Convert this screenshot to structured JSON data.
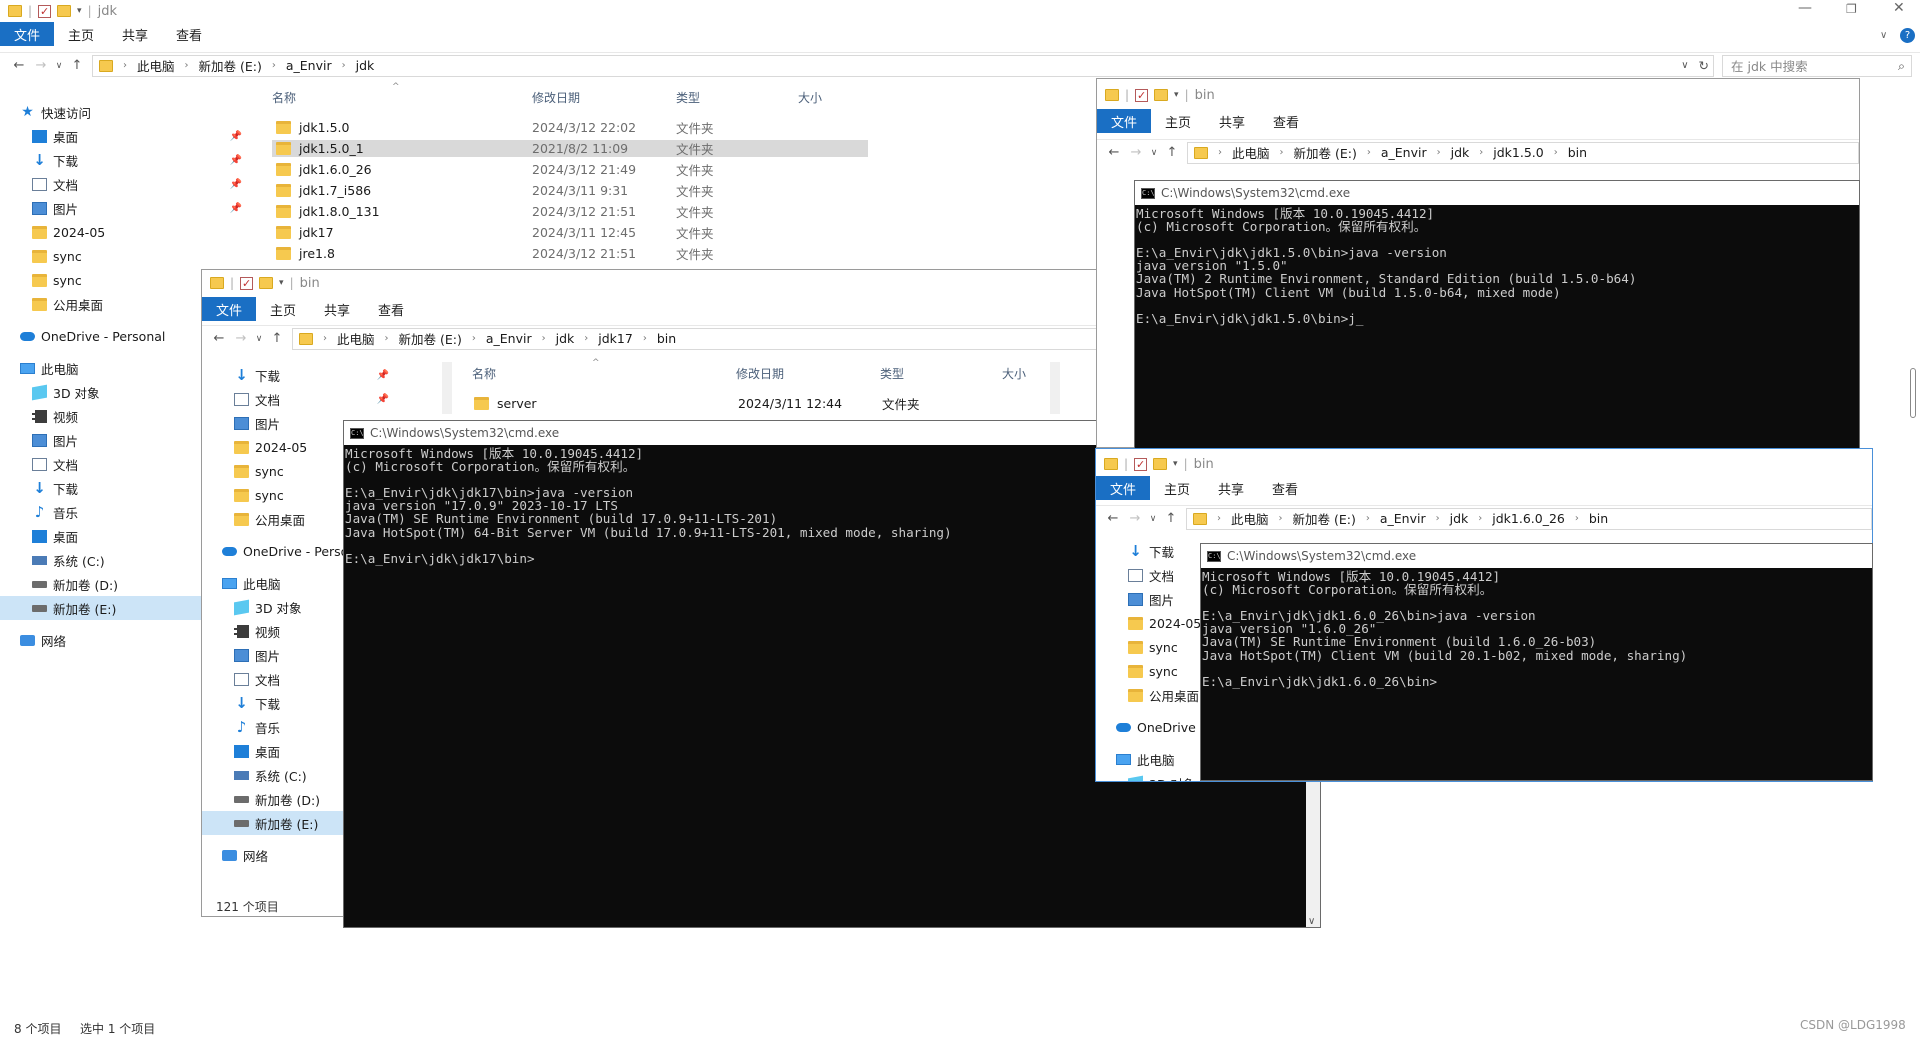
{
  "main": {
    "title": "jdk",
    "ribbon": [
      "文件",
      "主页",
      "共享",
      "查看"
    ],
    "breadcrumb": [
      "此电脑",
      "新加卷 (E:)",
      "a_Envir",
      "jdk"
    ],
    "search_placeholder": "在 jdk 中搜索",
    "columns": [
      "名称",
      "修改日期",
      "类型",
      "大小"
    ],
    "files": [
      {
        "name": "jdk1.5.0",
        "date": "2024/3/12 22:02",
        "type": "文件夹"
      },
      {
        "name": "jdk1.5.0_1",
        "date": "2021/8/2 11:09",
        "type": "文件夹"
      },
      {
        "name": "jdk1.6.0_26",
        "date": "2024/3/12 21:49",
        "type": "文件夹"
      },
      {
        "name": "jdk1.7_i586",
        "date": "2024/3/11 9:31",
        "type": "文件夹"
      },
      {
        "name": "jdk1.8.0_131",
        "date": "2024/3/12 21:51",
        "type": "文件夹"
      },
      {
        "name": "jdk17",
        "date": "2024/3/11 12:45",
        "type": "文件夹"
      },
      {
        "name": "jre1.8",
        "date": "2024/3/12 21:51",
        "type": "文件夹"
      }
    ],
    "nav": [
      {
        "label": "快速访问",
        "icon": "star-icon"
      },
      {
        "label": "桌面",
        "icon": "desktop-icon"
      },
      {
        "label": "下载",
        "icon": "download-icon"
      },
      {
        "label": "文档",
        "icon": "documents-icon"
      },
      {
        "label": "图片",
        "icon": "pictures-icon"
      },
      {
        "label": "2024-05",
        "icon": "folder-icon"
      },
      {
        "label": "sync",
        "icon": "folder-icon"
      },
      {
        "label": "sync",
        "icon": "folder-icon"
      },
      {
        "label": "公用桌面",
        "icon": "folder-icon"
      },
      {
        "label": "OneDrive - Personal",
        "icon": "cloud-icon"
      },
      {
        "label": "此电脑",
        "icon": "pc-icon"
      },
      {
        "label": "3D 对象",
        "icon": "3d-objects-icon"
      },
      {
        "label": "视频",
        "icon": "video-icon"
      },
      {
        "label": "图片",
        "icon": "pictures-icon"
      },
      {
        "label": "文档",
        "icon": "documents-icon"
      },
      {
        "label": "下载",
        "icon": "download-icon"
      },
      {
        "label": "音乐",
        "icon": "music-icon"
      },
      {
        "label": "桌面",
        "icon": "desktop-icon"
      },
      {
        "label": "系统 (C:)",
        "icon": "system-drive-icon"
      },
      {
        "label": "新加卷 (D:)",
        "icon": "drive-icon"
      },
      {
        "label": "新加卷 (E:)",
        "icon": "drive-icon"
      },
      {
        "label": "网络",
        "icon": "network-icon"
      }
    ],
    "status_items": "8 个项目",
    "status_selected": "选中 1 个项目",
    "watermark": "CSDN @LDG1998"
  },
  "win17": {
    "title": "bin",
    "ribbon": [
      "文件",
      "主页",
      "共享",
      "查看"
    ],
    "breadcrumb": [
      "此电脑",
      "新加卷 (E:)",
      "a_Envir",
      "jdk",
      "jdk17",
      "bin"
    ],
    "columns": [
      "名称",
      "修改日期",
      "类型",
      "大小"
    ],
    "row": {
      "name": "server",
      "date": "2024/3/11 12:44",
      "type": "文件夹"
    },
    "nav": [
      {
        "label": "下载",
        "icon": "download-icon"
      },
      {
        "label": "文档",
        "icon": "documents-icon"
      },
      {
        "label": "图片",
        "icon": "pictures-icon"
      },
      {
        "label": "2024-05",
        "icon": "folder-icon"
      },
      {
        "label": "sync",
        "icon": "folder-icon"
      },
      {
        "label": "sync",
        "icon": "folder-icon"
      },
      {
        "label": "公用桌面",
        "icon": "folder-icon"
      },
      {
        "label": "OneDrive - Perso",
        "icon": "cloud-icon"
      },
      {
        "label": "此电脑",
        "icon": "pc-icon"
      },
      {
        "label": "3D 对象",
        "icon": "3d-objects-icon"
      },
      {
        "label": "视频",
        "icon": "video-icon"
      },
      {
        "label": "图片",
        "icon": "pictures-icon"
      },
      {
        "label": "文档",
        "icon": "documents-icon"
      },
      {
        "label": "下载",
        "icon": "download-icon"
      },
      {
        "label": "音乐",
        "icon": "music-icon"
      },
      {
        "label": "桌面",
        "icon": "desktop-icon"
      },
      {
        "label": "系统 (C:)",
        "icon": "system-drive-icon"
      },
      {
        "label": "新加卷 (D:)",
        "icon": "drive-icon"
      },
      {
        "label": "新加卷 (E:)",
        "icon": "drive-icon"
      },
      {
        "label": "网络",
        "icon": "network-icon"
      }
    ],
    "status": "121 个项目",
    "cmd_title": "C:\\Windows\\System32\\cmd.exe",
    "cmd_lines": [
      "Microsoft Windows [版本 10.0.19045.4412]",
      "(c) Microsoft Corporation。保留所有权利。",
      "",
      "E:\\a_Envir\\jdk\\jdk17\\bin>java -version",
      "java version \"17.0.9\" 2023-10-17 LTS",
      "Java(TM) SE Runtime Environment (build 17.0.9+11-LTS-201)",
      "Java HotSpot(TM) 64-Bit Server VM (build 17.0.9+11-LTS-201, mixed mode, sharing)",
      "",
      "E:\\a_Envir\\jdk\\jdk17\\bin>"
    ]
  },
  "win15": {
    "title": "bin",
    "ribbon": [
      "文件",
      "主页",
      "共享",
      "查看"
    ],
    "breadcrumb": [
      "此电脑",
      "新加卷 (E:)",
      "a_Envir",
      "jdk",
      "jdk1.5.0",
      "bin"
    ],
    "cmd_title": "C:\\Windows\\System32\\cmd.exe",
    "cmd_lines": [
      "Microsoft Windows [版本 10.0.19045.4412]",
      "(c) Microsoft Corporation。保留所有权利。",
      "",
      "E:\\a_Envir\\jdk\\jdk1.5.0\\bin>java -version",
      "java version \"1.5.0\"",
      "Java(TM) 2 Runtime Environment, Standard Edition (build 1.5.0-b64)",
      "Java HotSpot(TM) Client VM (build 1.5.0-b64, mixed mode)",
      "",
      "E:\\a_Envir\\jdk\\jdk1.5.0\\bin>j_"
    ]
  },
  "win16": {
    "title": "bin",
    "ribbon": [
      "文件",
      "主页",
      "共享",
      "查看"
    ],
    "breadcrumb": [
      "此电脑",
      "新加卷 (E:)",
      "a_Envir",
      "jdk",
      "jdk1.6.0_26",
      "bin"
    ],
    "nav": [
      {
        "label": "下载",
        "icon": "download-icon"
      },
      {
        "label": "文档",
        "icon": "documents-icon"
      },
      {
        "label": "图片",
        "icon": "pictures-icon"
      },
      {
        "label": "2024-05",
        "icon": "folder-icon"
      },
      {
        "label": "sync",
        "icon": "folder-icon"
      },
      {
        "label": "sync",
        "icon": "folder-icon"
      },
      {
        "label": "公用桌面",
        "icon": "folder-icon"
      },
      {
        "label": "OneDrive",
        "icon": "cloud-icon"
      },
      {
        "label": "此电脑",
        "icon": "pc-icon"
      },
      {
        "label": "3D 对象",
        "icon": "3d-objects-icon"
      }
    ],
    "cmd_title": "C:\\Windows\\System32\\cmd.exe",
    "cmd_lines": [
      "Microsoft Windows [版本 10.0.19045.4412]",
      "(c) Microsoft Corporation。保留所有权利。",
      "",
      "E:\\a_Envir\\jdk\\jdk1.6.0_26\\bin>java -version",
      "java version \"1.6.0_26\"",
      "Java(TM) SE Runtime Environment (build 1.6.0_26-b03)",
      "Java HotSpot(TM) Client VM (build 20.1-b02, mixed mode, sharing)",
      "",
      "E:\\a_Envir\\jdk\\jdk1.6.0_26\\bin>"
    ]
  },
  "colors": {
    "accent": "#1a6fc4",
    "console_bg": "#0c0c0c",
    "console_fg": "#cccccc",
    "selection": "#cce4f7"
  }
}
